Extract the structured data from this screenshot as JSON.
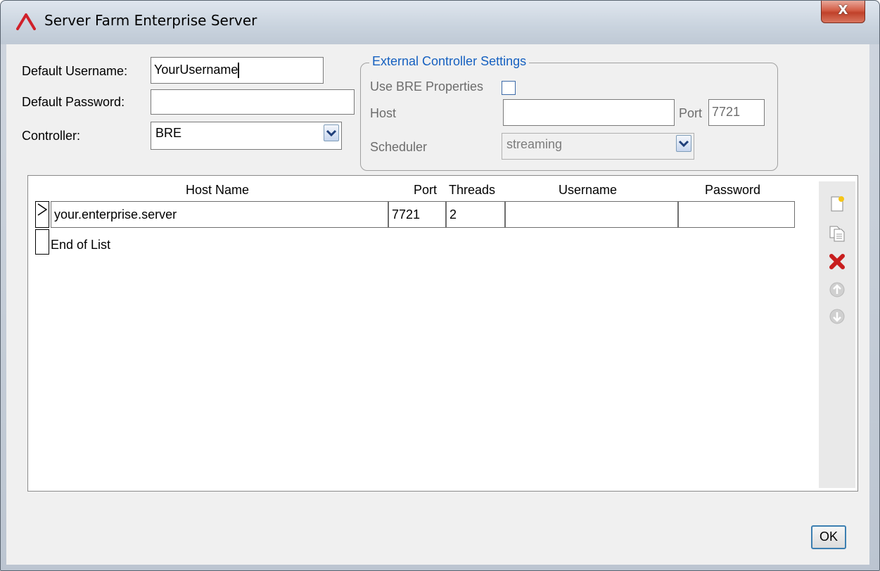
{
  "window": {
    "title": "Server Farm Enterprise Server",
    "close_label": "X"
  },
  "defaults": {
    "username_label": "Default Username:",
    "username_value": "YourUsername",
    "password_label": "Default Password:",
    "password_value": "",
    "controller_label": "Controller:",
    "controller_value": "BRE"
  },
  "external": {
    "legend": "External Controller Settings",
    "use_bre_label": "Use BRE Properties",
    "use_bre_checked": false,
    "host_label": "Host",
    "host_value": "",
    "port_label": "Port",
    "port_value": "7721",
    "scheduler_label": "Scheduler",
    "scheduler_value": "streaming"
  },
  "grid": {
    "columns": [
      "Host Name",
      "Port",
      "Threads",
      "Username",
      "Password"
    ],
    "rows": [
      {
        "host": "your.enterprise.server",
        "port": "7721",
        "threads": "2",
        "username": "",
        "password": ""
      }
    ],
    "end_label": "End of List"
  },
  "toolbar": [
    "new-item-icon",
    "copy-icon",
    "delete-icon",
    "move-up-icon",
    "move-down-icon"
  ],
  "ok_label": "OK",
  "colors": {
    "accent_blue": "#1560c0",
    "delete_red": "#c81e1e",
    "close_red": "#c0412a"
  }
}
